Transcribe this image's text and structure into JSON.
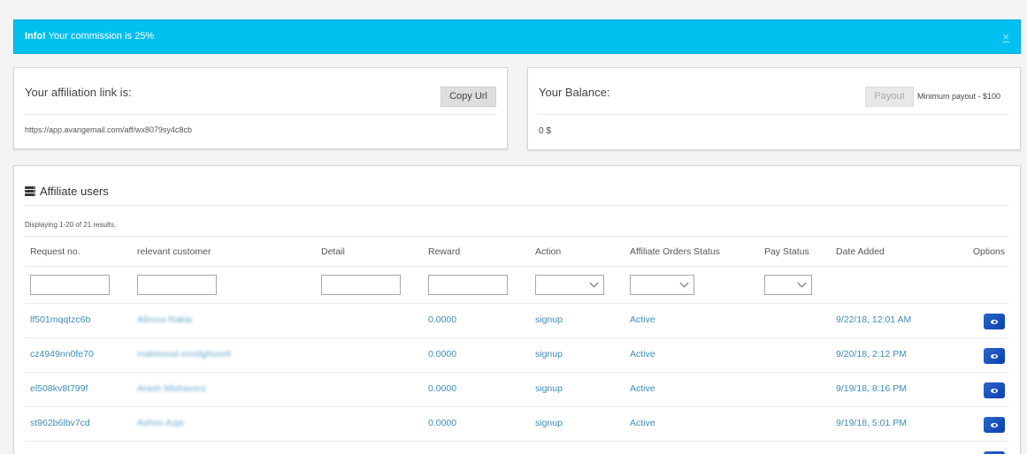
{
  "alert": {
    "strong": "Info!",
    "text": " Your commission is 25%",
    "close": "×"
  },
  "affiliation": {
    "title": "Your affiliation link is:",
    "copy_label": "Copy Url",
    "link": "https://app.avangemail.com/aff/wx8079sy4c8cb"
  },
  "balance": {
    "title": "Your Balance:",
    "payout_label": "Payout",
    "min_payout": "Minimum payout - $100",
    "value": "0 $"
  },
  "users": {
    "title": "Affiliate users",
    "summary": "Displaying 1-20 of 21 results.",
    "columns": [
      "Request no.",
      "relevant customer",
      "Detail",
      "Reward",
      "Action",
      "Affiliate Orders Status",
      "Pay Status",
      "Date Added",
      "Options"
    ],
    "rows": [
      {
        "request": "lf501mqqtzc6b",
        "customer": "Alireza Rakia",
        "detail": "",
        "reward": "0.0000",
        "action": "signup",
        "status": "Active",
        "pay": "",
        "date": "9/22/18, 12:01 AM"
      },
      {
        "request": "cz4949nn0fe70",
        "customer": "mahmood emolghoseti",
        "detail": "",
        "reward": "0.0000",
        "action": "signup",
        "status": "Active",
        "pay": "",
        "date": "9/20/18, 2:12 PM"
      },
      {
        "request": "el508kv8t799f",
        "customer": "Arash Mishaverz",
        "detail": "",
        "reward": "0.0000",
        "action": "signup",
        "status": "Active",
        "pay": "",
        "date": "9/19/18, 8:16 PM"
      },
      {
        "request": "st962b6lbv7cd",
        "customer": "Ashno Azpi",
        "detail": "",
        "reward": "0.0000",
        "action": "signup",
        "status": "Active",
        "pay": "",
        "date": "9/19/18, 5:01 PM"
      }
    ]
  },
  "colors": {
    "info": "#00c0ef",
    "link": "#3c8dbc",
    "view_button": "#1c4fbf"
  },
  "icons": {
    "users_title": "server-icon",
    "view": "eye-icon"
  }
}
